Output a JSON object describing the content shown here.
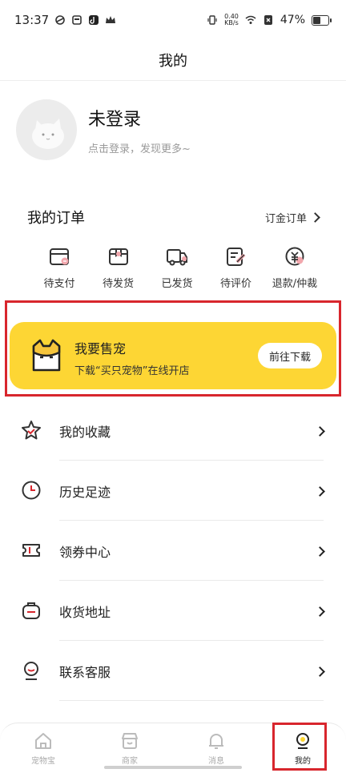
{
  "status": {
    "time": "13:37",
    "net_speed_value": "0.40",
    "net_speed_unit": "KB/s",
    "battery": "47%"
  },
  "title": "我的",
  "profile": {
    "name": "未登录",
    "subtitle": "点击登录，发现更多~"
  },
  "orders": {
    "title": "我的订单",
    "link": "订金订单",
    "items": [
      {
        "label": "待支付",
        "icon": "wallet-icon"
      },
      {
        "label": "待发货",
        "icon": "box-icon"
      },
      {
        "label": "已发货",
        "icon": "truck-icon"
      },
      {
        "label": "待评价",
        "icon": "review-icon"
      },
      {
        "label": "退款/仲裁",
        "icon": "refund-icon"
      }
    ]
  },
  "banner": {
    "title": "我要售宠",
    "subtitle": "下载“买只宠物”在线开店",
    "button": "前往下载"
  },
  "menu": [
    {
      "label": "我的收藏",
      "icon": "star-icon"
    },
    {
      "label": "历史足迹",
      "icon": "clock-icon"
    },
    {
      "label": "领券中心",
      "icon": "coupon-icon"
    },
    {
      "label": "收货地址",
      "icon": "address-icon"
    },
    {
      "label": "联系客服",
      "icon": "service-icon"
    }
  ],
  "tabs": [
    {
      "label": "宠物宝",
      "icon": "home-icon",
      "active": false
    },
    {
      "label": "商家",
      "icon": "shop-icon",
      "active": false
    },
    {
      "label": "消息",
      "icon": "bell-icon",
      "active": false
    },
    {
      "label": "我的",
      "icon": "profile-icon",
      "active": true
    }
  ],
  "colors": {
    "accent": "#fdd634",
    "highlight": "#d8262d",
    "icon_accent": "#f2a7ad"
  }
}
